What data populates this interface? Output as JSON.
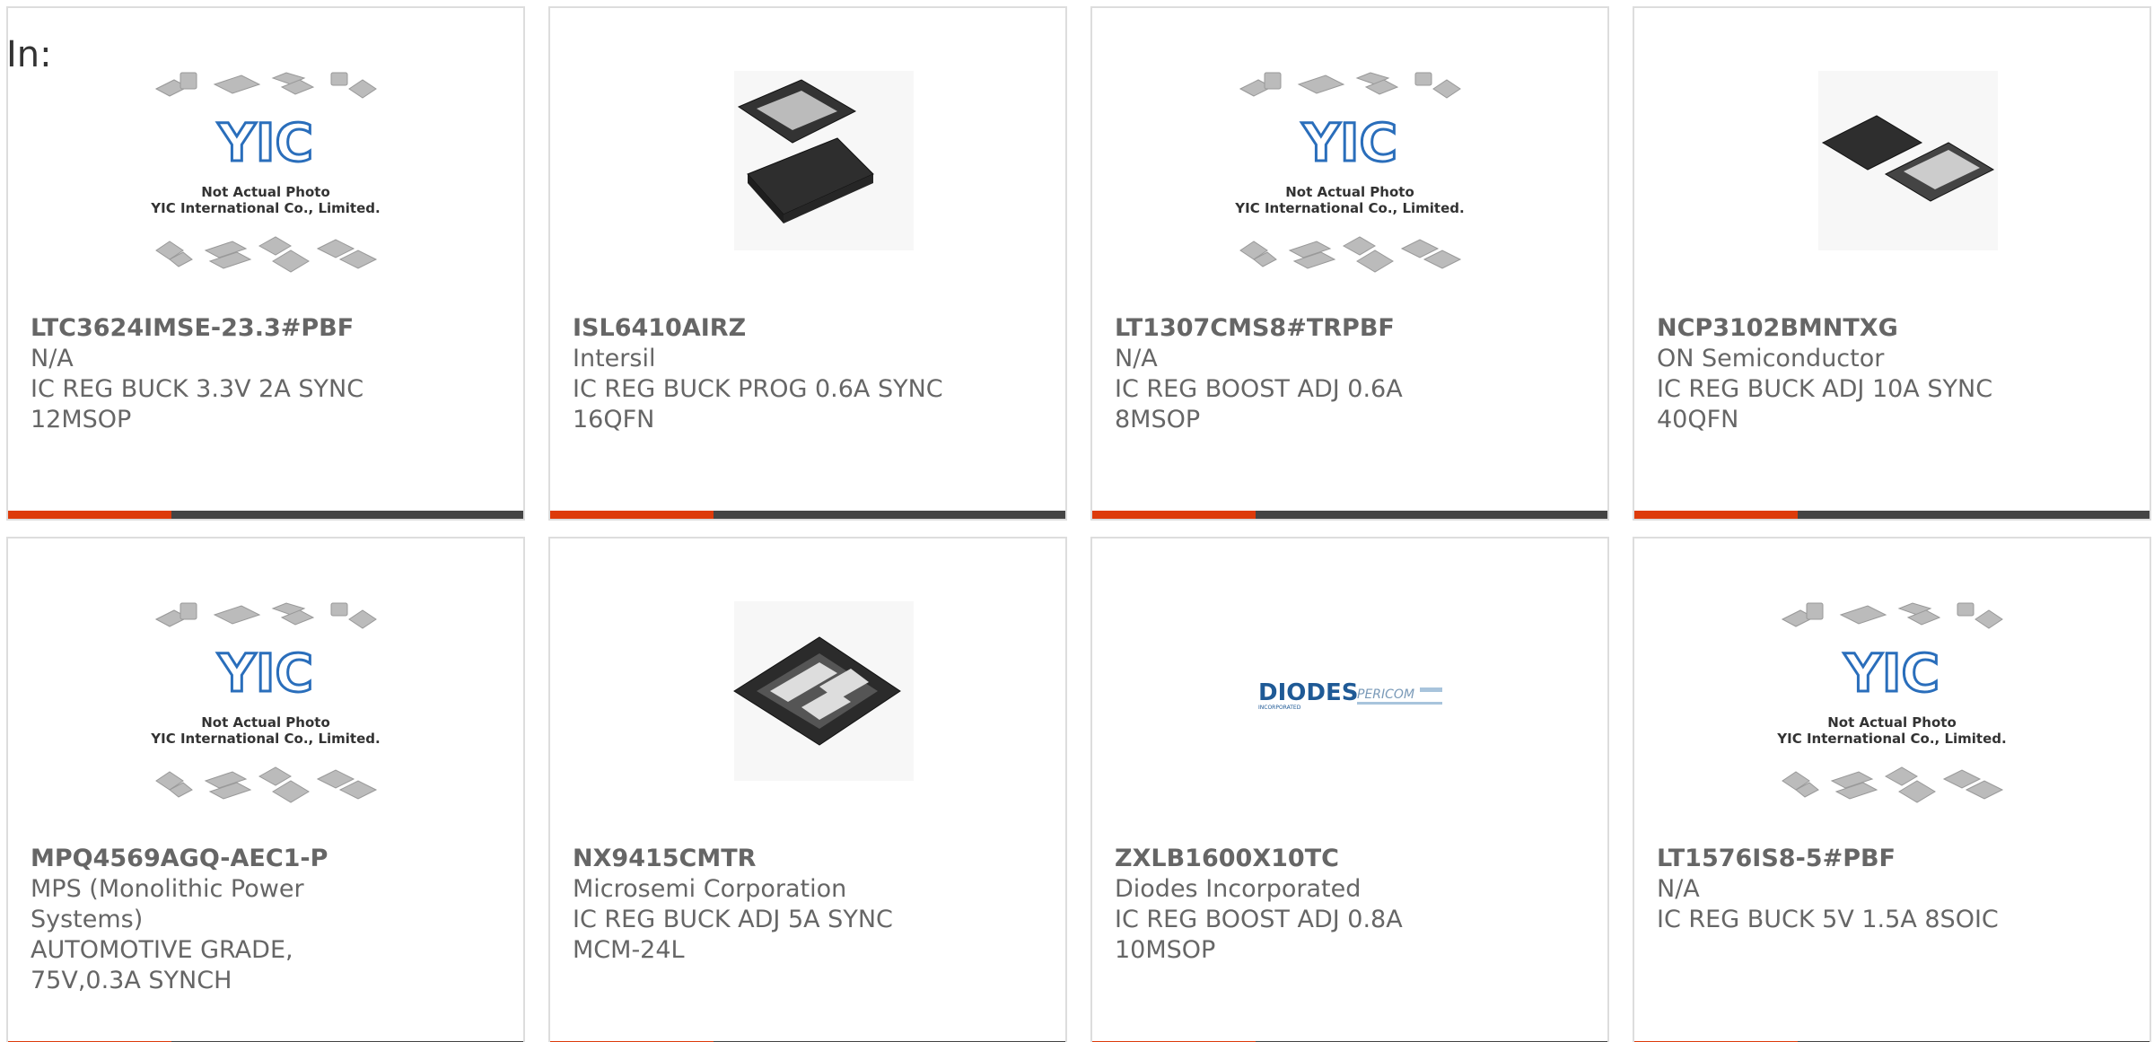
{
  "header": {
    "in_label": "In:"
  },
  "products": [
    {
      "part_number": "LTC3624IMSE-23.3#PBF",
      "manufacturer": "N/A",
      "description": "IC REG BUCK 3.3V 2A SYNC 12MSOP",
      "image": "yic-placeholder"
    },
    {
      "part_number": "ISL6410AIRZ",
      "manufacturer": "Intersil",
      "description": "IC REG BUCK PROG 0.6A SYNC 16QFN",
      "image": "qfn-chip"
    },
    {
      "part_number": "LT1307CMS8#TRPBF",
      "manufacturer": "N/A",
      "description": "IC REG BOOST ADJ 0.6A 8MSOP",
      "image": "yic-placeholder"
    },
    {
      "part_number": "NCP3102BMNTXG",
      "manufacturer": "ON Semiconductor",
      "description": "IC REG BUCK ADJ 10A SYNC 40QFN",
      "image": "qfn-large-chip"
    },
    {
      "part_number": "MPQ4569AGQ-AEC1-P",
      "manufacturer": "MPS (Monolithic Power Systems)",
      "description": "AUTOMOTIVE GRADE, 75V,0.3A SYNCH",
      "image": "yic-placeholder"
    },
    {
      "part_number": "NX9415CMTR",
      "manufacturer": "Microsemi Corporation",
      "description": "IC REG BUCK ADJ 5A SYNC MCM-24L",
      "image": "mcm-chip"
    },
    {
      "part_number": "ZXLB1600X10TC",
      "manufacturer": "Diodes Incorporated",
      "description": "IC REG BOOST ADJ 0.8A 10MSOP",
      "image": "diodes-logo"
    },
    {
      "part_number": "LT1576IS8-5#PBF",
      "manufacturer": "N/A",
      "description": "IC REG BUCK 5V 1.5A 8SOIC",
      "image": "yic-placeholder"
    }
  ],
  "placeholder": {
    "logo_text": "YIC",
    "line1": "Not Actual Photo",
    "line2": "YIC International Co., Limited."
  },
  "diodes_logo": {
    "brand": "DIODES",
    "sub": "INCORPORATED",
    "brand2": "PERICOM"
  },
  "colors": {
    "accent": "#dd3b0b",
    "bar": "#444444",
    "border": "#dddddd",
    "text": "#666666",
    "yic_blue": "#2a6ebb"
  }
}
